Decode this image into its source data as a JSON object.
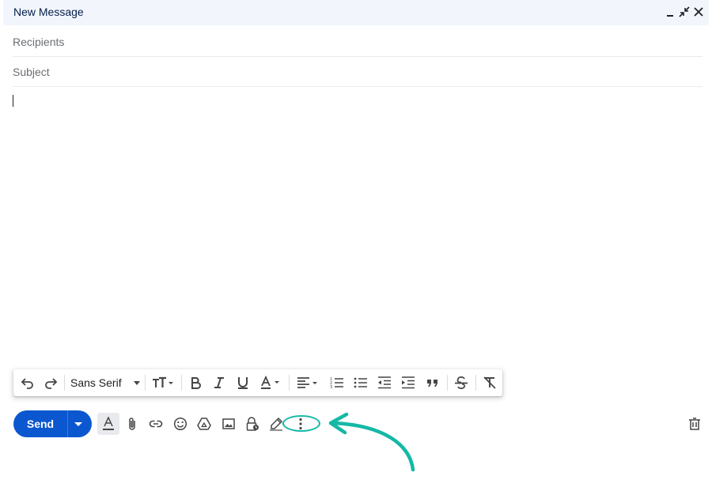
{
  "window": {
    "title": "New Message",
    "controls": [
      "minimize-icon",
      "exit-fullscreen-icon",
      "close-icon"
    ]
  },
  "fields": {
    "recipients_placeholder": "Recipients",
    "recipients_value": "",
    "subject_placeholder": "Subject",
    "subject_value": ""
  },
  "body": {
    "text": ""
  },
  "formatting_toolbar": {
    "font_name": "Sans Serif",
    "buttons": [
      "undo-icon",
      "redo-icon",
      "font-size-icon",
      "bold-icon",
      "italic-icon",
      "underline-icon",
      "text-color-icon",
      "align-icon",
      "numbered-list-icon",
      "bulleted-list-icon",
      "indent-less-icon",
      "indent-more-icon",
      "quote-icon",
      "strikethrough-icon",
      "remove-formatting-icon"
    ]
  },
  "bottom_toolbar": {
    "send_label": "Send",
    "buttons": [
      "formatting-options-icon",
      "attach-icon",
      "link-icon",
      "emoji-icon",
      "drive-icon",
      "photo-icon",
      "confidential-icon",
      "signature-icon",
      "more-options-icon",
      "trash-icon"
    ]
  },
  "colors": {
    "header_bg": "#f2f6fc",
    "send_bg": "#0b57d0",
    "annotation": "#14b8a6"
  }
}
